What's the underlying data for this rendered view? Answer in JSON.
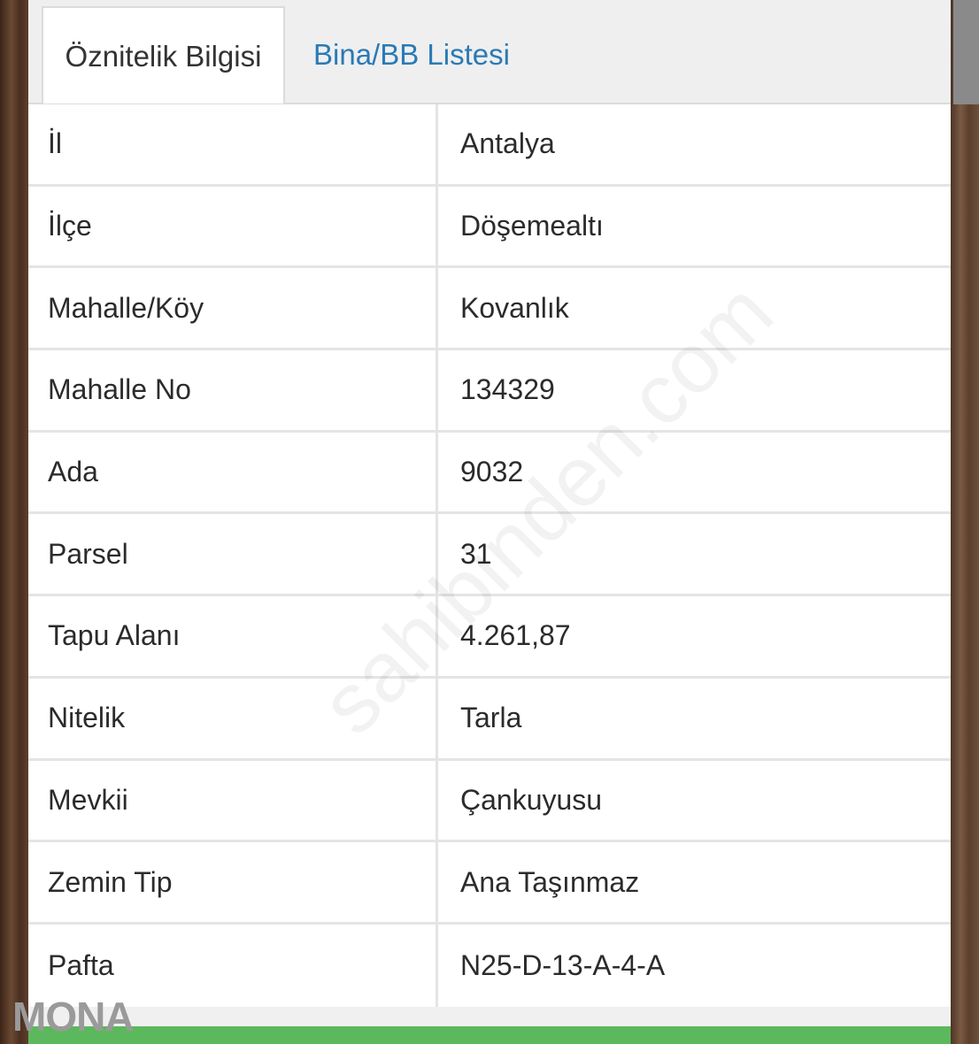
{
  "tabs": [
    {
      "label": "Öznitelik Bilgisi",
      "active": true
    },
    {
      "label": "Bina/BB Listesi",
      "active": false
    }
  ],
  "rows": [
    {
      "key": "İl",
      "value": "Antalya"
    },
    {
      "key": "İlçe",
      "value": "Döşemealtı"
    },
    {
      "key": "Mahalle/Köy",
      "value": "Kovanlık"
    },
    {
      "key": "Mahalle No",
      "value": "134329"
    },
    {
      "key": "Ada",
      "value": "9032"
    },
    {
      "key": "Parsel",
      "value": "31"
    },
    {
      "key": "Tapu Alanı",
      "value": "4.261,87"
    },
    {
      "key": "Nitelik",
      "value": "Tarla"
    },
    {
      "key": "Mevkii",
      "value": "Çankuyusu"
    },
    {
      "key": "Zemin Tip",
      "value": "Ana Taşınmaz"
    },
    {
      "key": "Pafta",
      "value": "N25-D-13-A-4-A"
    }
  ],
  "watermark": "sahibinden.com",
  "logo": "MONA",
  "colors": {
    "tab_link": "#2a7ab5",
    "bottom_bar": "#5cb85c"
  }
}
